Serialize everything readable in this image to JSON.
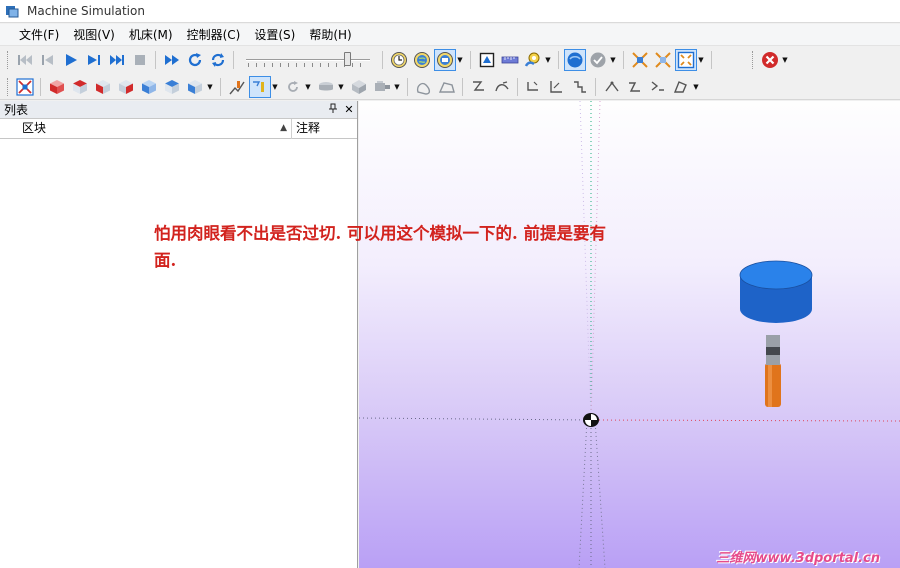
{
  "window": {
    "title": "Machine Simulation"
  },
  "menu": [
    {
      "label": "文件(F)"
    },
    {
      "label": "视图(V)"
    },
    {
      "label": "机床(M)"
    },
    {
      "label": "控制器(C)"
    },
    {
      "label": "设置(S)"
    },
    {
      "label": "帮助(H)"
    }
  ],
  "toolbar1": {
    "playback": [
      "skip-to-start-icon",
      "step-back-icon",
      "play-icon",
      "step-forward-icon",
      "skip-to-end-icon",
      "stop-icon"
    ],
    "speed_slider": {
      "value_fraction": 0.84
    },
    "colors": {
      "accent": "#1f6fd1",
      "stop": "#d12b2b"
    }
  },
  "list_panel": {
    "title": "列表",
    "pin_glyph": "ꟷ",
    "close_glyph": "✕",
    "columns": [
      {
        "label": "区块"
      },
      {
        "label": "注释"
      }
    ],
    "rows": []
  },
  "viewport": {
    "annotation": "怕用肉眼看不出是否过切. 可以用这个模拟一下的. 前提是要有面.",
    "axis_colors": {
      "x": "#e0445a",
      "y": "#1fae7f",
      "z": "#6a6a8a"
    },
    "tool_colors": {
      "holder": "#2a72e0",
      "shank": "#9aa0a8",
      "cutter": "#e0741c"
    }
  },
  "watermark": "三维网www.3dportal.cn"
}
